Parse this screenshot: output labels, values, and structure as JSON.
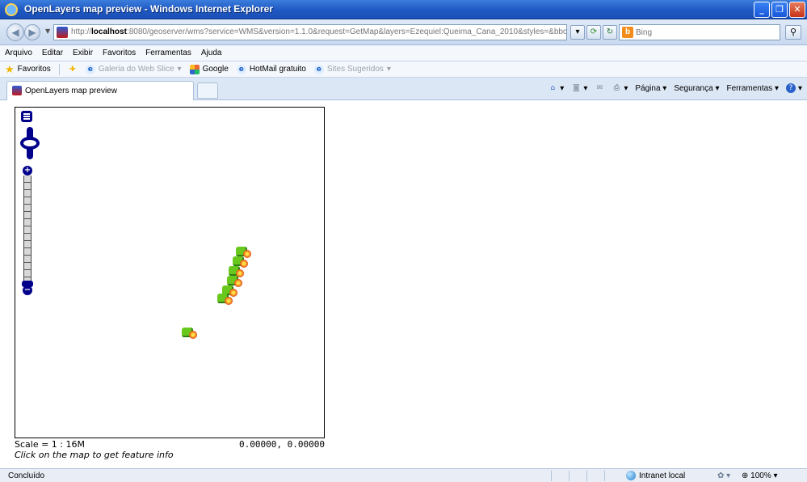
{
  "window": {
    "title": "OpenLayers map preview - Windows Internet Explorer",
    "minimize": "_",
    "maximize": "❐",
    "close": "✕"
  },
  "address": {
    "url_prefix": "http://",
    "url_host": "localhost",
    "url_rest": ":8080/geoserver/wms?service=WMS&version=1.1.0&request=GetMap&layers=Ezequiel:Queima_Cana_2010&styles=&bbox=-44.804,-14.015,",
    "search_placeholder": "Bing"
  },
  "menu": [
    "Arquivo",
    "Editar",
    "Exibir",
    "Favoritos",
    "Ferramentas",
    "Ajuda"
  ],
  "favorites": {
    "favorites_label": "Favoritos",
    "items": [
      {
        "label": "Galeria do Web Slice",
        "dropdown": "▾",
        "disabled": true
      },
      {
        "label": "Google",
        "dropdown": "",
        "disabled": false
      },
      {
        "label": "HotMail gratuito",
        "dropdown": "",
        "disabled": false
      },
      {
        "label": "Sites Sugeridos",
        "dropdown": "▾",
        "disabled": true
      }
    ]
  },
  "tab": {
    "label": "OpenLayers map preview"
  },
  "commands": {
    "page": "Página ▾",
    "security": "Segurança ▾",
    "tools": "Ferramentas ▾"
  },
  "map": {
    "scale": "Scale = 1 : 16M",
    "coords": "0.00000, 0.00000",
    "hint": "Click on the map to get feature info",
    "zoom_in": "+",
    "zoom_out": "−"
  },
  "status": {
    "text": "Concluído",
    "zone": "Intranet local",
    "zoom": "100%  ▾"
  }
}
